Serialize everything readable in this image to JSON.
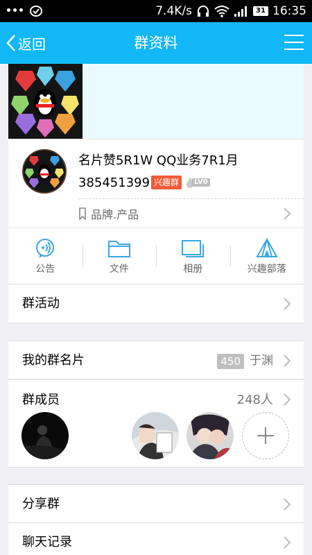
{
  "status_bar": {
    "speed": "7.4K/s",
    "battery": "31",
    "time": "16:35"
  },
  "header": {
    "back_label": "返回",
    "title": "群资料"
  },
  "group": {
    "name": "名片赞5R1W QQ业务7R1月",
    "id": "385451399",
    "badge": "兴趣群",
    "level": "LV0",
    "tag": "品牌.产品"
  },
  "actions": [
    {
      "label": "公告",
      "icon": "announcement-icon"
    },
    {
      "label": "文件",
      "icon": "folder-icon"
    },
    {
      "label": "相册",
      "icon": "album-icon"
    },
    {
      "label": "兴趣部落",
      "icon": "tribe-tent-icon"
    }
  ],
  "rows": {
    "activity": "群活动",
    "my_card": "我的群名片",
    "my_card_count": "450",
    "my_card_nick": "于渊",
    "members": "群成员",
    "members_count": "248人",
    "share": "分享群",
    "history": "聊天记录"
  },
  "colors": {
    "accent": "#12b7f5",
    "badge": "#f25b3a"
  }
}
